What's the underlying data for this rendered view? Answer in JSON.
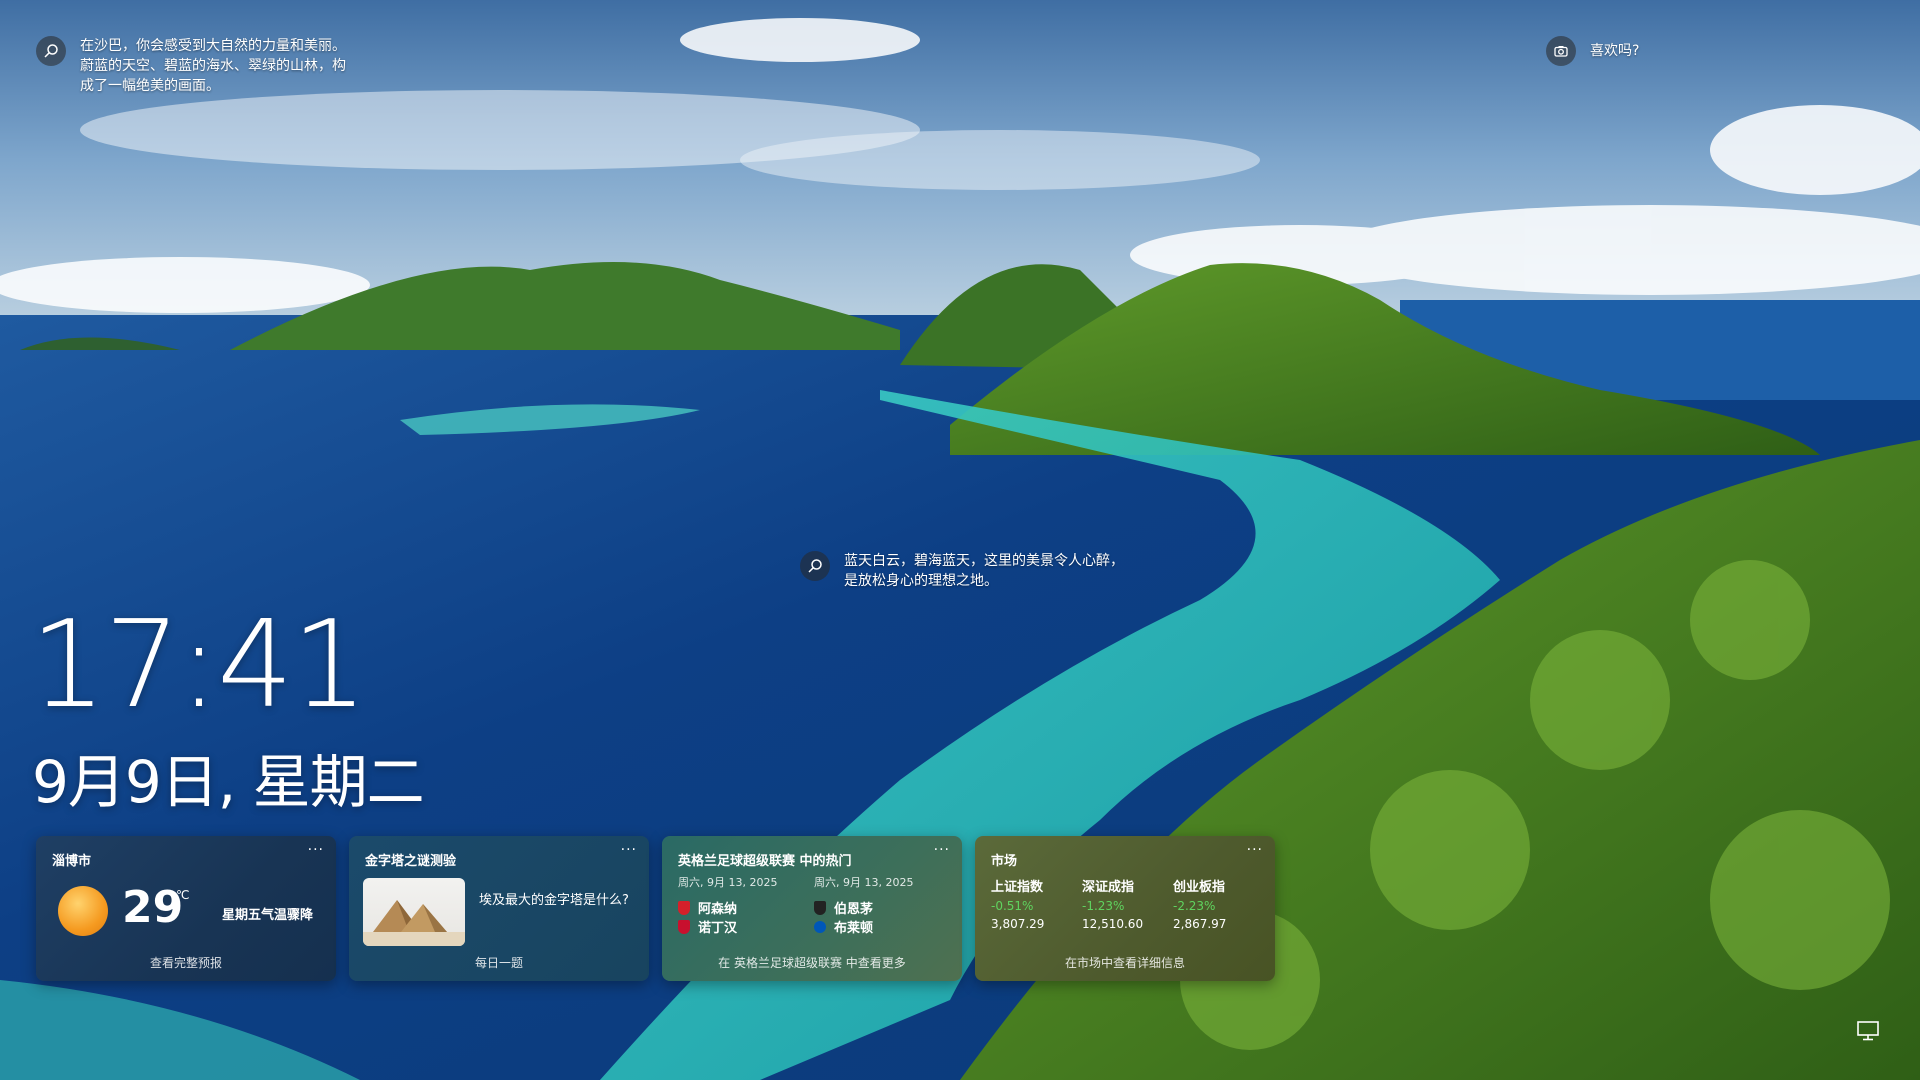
{
  "captions": {
    "top_left": "在沙巴，你会感受到大自然的力量和美丽。蔚蓝的天空、碧蓝的海水、翠绿的山林，构成了一幅绝美的画面。",
    "top_right": "喜欢吗?",
    "middle": "蓝天白云，碧海蓝天，这里的美景令人心醉，是放松身心的理想之地。"
  },
  "clock": {
    "time": "17:41",
    "date": "9月9日, 星期二"
  },
  "widgets": {
    "weather": {
      "title": "淄博市",
      "more": "···",
      "temperature": "29",
      "unit": "℃",
      "note": "星期五气温骤降",
      "footer": "查看完整预报"
    },
    "quiz": {
      "title": "金字塔之谜测验",
      "more": "···",
      "question": "埃及最大的金字塔是什么?",
      "footer": "每日一题"
    },
    "sports": {
      "title": "英格兰足球超级联赛 中的热门",
      "more": "···",
      "matches": [
        {
          "date": "周六, 9月 13, 2025",
          "home": "阿森纳",
          "away": "诺丁汉",
          "home_color": "#d4202a",
          "away_color": "#c8102e"
        },
        {
          "date": "周六, 9月 13, 2025",
          "home": "伯恩茅",
          "away": "布莱顿",
          "home_color": "#222222",
          "away_color": "#0057b8"
        }
      ],
      "footer": "在 英格兰足球超级联赛 中查看更多"
    },
    "market": {
      "title": "市场",
      "more": "···",
      "indices": [
        {
          "name": "上证指数",
          "change": "-0.51%",
          "value": "3,807.29"
        },
        {
          "name": "深证成指",
          "change": "-1.23%",
          "value": "12,510.60"
        },
        {
          "name": "创业板指",
          "change": "-2.23%",
          "value": "2,867.97"
        }
      ],
      "footer": "在市场中查看详细信息"
    }
  },
  "colors": {
    "change_text": "#5fd35f"
  }
}
